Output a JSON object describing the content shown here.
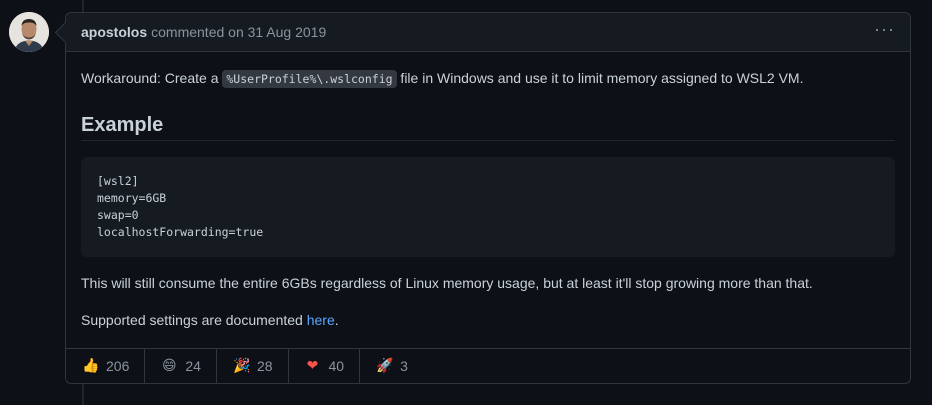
{
  "comment": {
    "author": "apostolos",
    "meta": "commented on 31 Aug 2019",
    "menu_icon": "kebab-horizontal-icon",
    "body": {
      "p1_before": "Workaround: Create a ",
      "p1_code": "%UserProfile%\\.wslconfig",
      "p1_after": " file in Windows and use it to limit memory assigned to WSL2 VM.",
      "heading": "Example",
      "code_lines": [
        "[wsl2]",
        "memory=6GB",
        "swap=0",
        "localhostForwarding=true"
      ],
      "p2": "This will still consume the entire 6GBs regardless of Linux memory usage, but at least it'll stop growing more than that.",
      "p3_before": "Supported settings are documented ",
      "p3_link": "here",
      "p3_after": "."
    },
    "reactions": [
      {
        "icon": "thumbs-up-icon",
        "glyph": "👍",
        "count": "206"
      },
      {
        "icon": "laugh-icon",
        "glyph": "😄",
        "count": "24"
      },
      {
        "icon": "hooray-icon",
        "glyph": "🎉",
        "count": "28"
      },
      {
        "icon": "heart-icon",
        "glyph": "❤",
        "count": "40"
      },
      {
        "icon": "rocket-icon",
        "glyph": "🚀",
        "count": "3"
      }
    ]
  },
  "colors": {
    "background": "#0d1117",
    "header_bg": "#161b22",
    "border": "#30363d",
    "link": "#58a6ff",
    "muted": "#8b949e",
    "heart": "#f85149"
  }
}
